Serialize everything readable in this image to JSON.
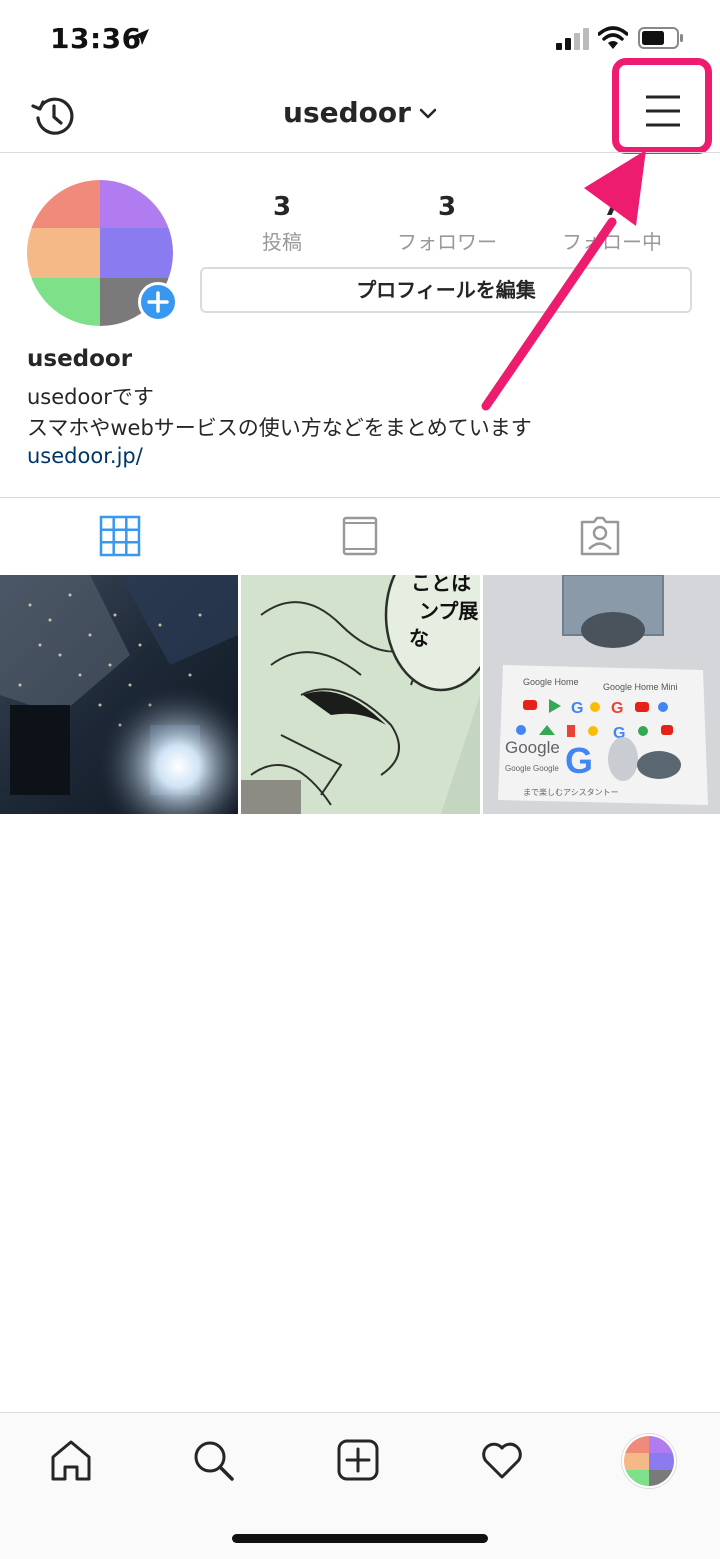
{
  "status_bar": {
    "time": "13:36",
    "icons": [
      "location-arrow-icon",
      "cell-signal-icon",
      "wifi-icon",
      "battery-icon"
    ]
  },
  "header": {
    "username": "usedoor",
    "left_icon": "history-icon",
    "right_icon": "hamburger-menu-icon",
    "highlight_color": "#ed1c6f"
  },
  "profile": {
    "stats": [
      {
        "count": "3",
        "label": "投稿"
      },
      {
        "count": "3",
        "label": "フォロワー"
      },
      {
        "count": "7",
        "label": "フォロー中"
      }
    ],
    "edit_button_label": "プロフィールを編集",
    "name": "usedoor",
    "bio_line1": "usedoorです",
    "bio_line2": "スマホやwebサービスの使い方などをまとめています",
    "link": "usedoor.jp/"
  },
  "tabs": [
    {
      "icon": "grid-icon",
      "active": true
    },
    {
      "icon": "feed-view-icon",
      "active": false
    },
    {
      "icon": "tagged-photos-icon",
      "active": false
    }
  ],
  "posts": [
    {
      "icon": "city-night-photo"
    },
    {
      "icon": "manga-exhibit-photo"
    },
    {
      "icon": "google-home-stickers-photo"
    }
  ],
  "bottom_nav": [
    "home-icon",
    "search-icon",
    "new-post-icon",
    "activity-heart-icon",
    "profile-avatar-icon"
  ],
  "colors": {
    "active_tab": "#3897f0",
    "link": "#003569",
    "annotation": "#ed1c6f"
  }
}
